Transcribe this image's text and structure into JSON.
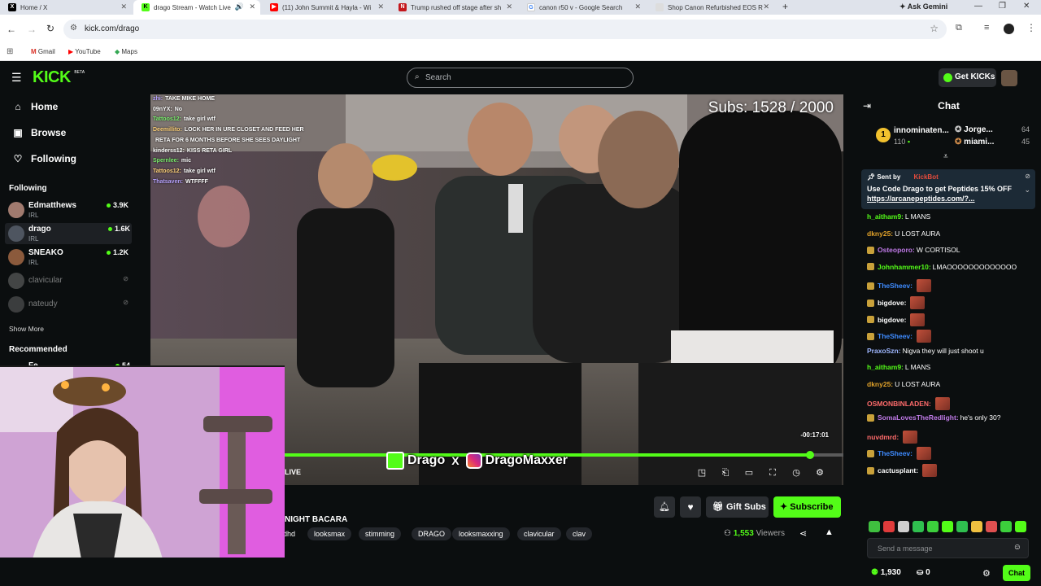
{
  "browser": {
    "tabs": [
      {
        "title": "Home / X"
      },
      {
        "title": "drago Stream - Watch Live"
      },
      {
        "title": "(11) John Summit & Hayla - Wi"
      },
      {
        "title": "Trump rushed off stage after sh"
      },
      {
        "title": "canon r50 v - Google Search"
      },
      {
        "title": "Shop Canon Refurbished EOS R"
      }
    ],
    "ask_gemini": "Ask Gemini",
    "url": "kick.com/drago",
    "bookmarks": [
      "Gmail",
      "YouTube",
      "Maps"
    ]
  },
  "kick": {
    "logo": "KICK",
    "logo_beta": "BETA",
    "search_placeholder": "Search",
    "get_kicks": "Get KICKs",
    "nav": {
      "home": "Home",
      "browse": "Browse",
      "following": "Following"
    },
    "following_title": "Following",
    "following": [
      {
        "name": "Edmatthews",
        "category": "IRL",
        "viewers": "3.9K",
        "live": true
      },
      {
        "name": "drago",
        "category": "IRL",
        "viewers": "1.6K",
        "live": true
      },
      {
        "name": "SNEAKO",
        "category": "IRL",
        "viewers": "1.2K",
        "live": true
      },
      {
        "name": "clavicular",
        "category": "",
        "viewers": "",
        "live": false
      },
      {
        "name": "nateudy",
        "category": "",
        "viewers": "",
        "live": false
      }
    ],
    "show_more": "Show More",
    "recommended_title": "Recommended",
    "recommended_partial": {
      "name": "Fe...",
      "viewers": "54"
    },
    "player": {
      "subs_goal": "Subs: 1528 / 2000",
      "overlay_chat": [
        {
          "user": "zhi:",
          "text": "TAKE MIKE HOME"
        },
        {
          "user": "09nYX:",
          "text": "No"
        },
        {
          "user": "Tattoos12:",
          "text": "take girl wtf"
        },
        {
          "user": "Deemillito:",
          "text": "LOCK HER IN URE CLOSET AND FEED HER"
        },
        {
          "user": "",
          "text": "RETA FOR 6 MONTHS BEFORE SHE SEES DAYLIGHT"
        },
        {
          "user": "kinderss12:",
          "text": "KISS RETA GIRL"
        },
        {
          "user": "Spernlee:",
          "text": "mic"
        },
        {
          "user": "Tattoos12:",
          "text": "take girl wtf"
        },
        {
          "user": "Thatsaven:",
          "text": "WTFFFF"
        }
      ],
      "time_remaining": "-00:17:01",
      "live_label": "LIVE",
      "progress": 0.94,
      "brand_left": "Drago",
      "brand_x": "X",
      "brand_right": "DragoMaxxer"
    },
    "stream": {
      "title_partial": "NIGHT BACARA",
      "tags": [
        "dhd",
        "looksmax",
        "stimming",
        "DRAGO",
        "looksmaxxing",
        "clavicular",
        "clav"
      ],
      "viewers": "1,553",
      "viewers_label": "Viewers",
      "gift_subs": "Gift Subs",
      "subscribe": "Subscribe"
    },
    "chat": {
      "title": "Chat",
      "gifters": [
        {
          "name": "innominaten...",
          "count": "110"
        },
        {
          "name": "Jorge...",
          "count": "64"
        },
        {
          "name": "miami...",
          "count": "45"
        }
      ],
      "pinned": {
        "sent_by": "Sent by",
        "sender": "KickBot",
        "text": "Use Code Drago to get Peptides 15% OFF",
        "link": "https://arcanepeptides.com/?..."
      },
      "messages": [
        {
          "user": "h_aitham9:",
          "text": "L MANS",
          "color": "#53fc18",
          "badge": false,
          "emote": false
        },
        {
          "user": "dkny25:",
          "text": "U LOST AURA",
          "color": "#e3a32a",
          "badge": false,
          "emote": false
        },
        {
          "user": "Osteoporo:",
          "text": "W CORTISOL",
          "color": "#c07ae8",
          "badge": true,
          "emote": false
        },
        {
          "user": "Johnhammer10:",
          "text": "LMAOOOOOOOOOOOOO",
          "color": "#53fc18",
          "badge": true,
          "emote": false
        },
        {
          "user": "TheSheev:",
          "text": "",
          "color": "#3e8bff",
          "badge": true,
          "emote": true
        },
        {
          "user": "bigdove:",
          "text": "",
          "color": "#ffffff",
          "badge": true,
          "emote": true
        },
        {
          "user": "bigdove:",
          "text": "",
          "color": "#ffffff",
          "badge": true,
          "emote": true
        },
        {
          "user": "TheSheev:",
          "text": "",
          "color": "#3e8bff",
          "badge": true,
          "emote": true
        },
        {
          "user": "PraxoSzn:",
          "text": "Nigva they will just shoot u",
          "color": "#9fb7ff",
          "badge": false,
          "emote": false
        },
        {
          "user": "h_aitham9:",
          "text": "L MANS",
          "color": "#53fc18",
          "badge": false,
          "emote": false
        },
        {
          "user": "dkny25:",
          "text": "U LOST AURA",
          "color": "#e3a32a",
          "badge": false,
          "emote": false
        },
        {
          "user": "OSMONBINLADEN:",
          "text": "",
          "color": "#ff6b6b",
          "badge": false,
          "emote": true
        },
        {
          "user": "SomaLovesTheRedlight:",
          "text": "he's only 30?",
          "color": "#c07ae8",
          "badge": true,
          "emote": false
        },
        {
          "user": "nuvdmrd:",
          "text": "",
          "color": "#ff6b6b",
          "badge": false,
          "emote": true
        },
        {
          "user": "TheSheev:",
          "text": "",
          "color": "#3e8bff",
          "badge": true,
          "emote": true
        },
        {
          "user": "cactusplant:",
          "text": "",
          "color": "#ffffff",
          "badge": true,
          "emote": true
        }
      ],
      "input_placeholder": "Send a message",
      "points": "1,930",
      "drops": "0",
      "send_label": "Chat"
    }
  },
  "colors": {
    "accent": "#53fc18"
  }
}
